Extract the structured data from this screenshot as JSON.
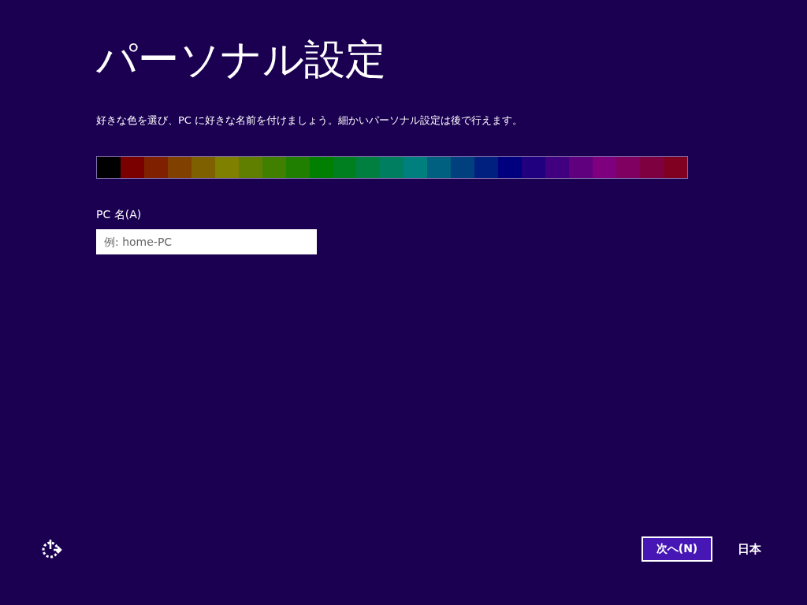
{
  "title": "パーソナル設定",
  "description": "好きな色を選び、PC に好きな名前を付けましょう。細かいパーソナル設定は後で行えます。",
  "swatches": [
    {
      "color": "#000000"
    },
    {
      "color": "#7a0000"
    },
    {
      "color": "#7f2000"
    },
    {
      "color": "#7f4000"
    },
    {
      "color": "#7f6000"
    },
    {
      "color": "#7f7f00"
    },
    {
      "color": "#607f00"
    },
    {
      "color": "#407f00"
    },
    {
      "color": "#207f00"
    },
    {
      "color": "#007f00"
    },
    {
      "color": "#007f20"
    },
    {
      "color": "#007f40"
    },
    {
      "color": "#007f60"
    },
    {
      "color": "#007f7f"
    },
    {
      "color": "#00607f"
    },
    {
      "color": "#00407f"
    },
    {
      "color": "#00207f"
    },
    {
      "color": "#00007f"
    },
    {
      "color": "#20007f"
    },
    {
      "color": "#40007f"
    },
    {
      "color": "#60007f"
    },
    {
      "color": "#7f007f"
    },
    {
      "color": "#7f0060"
    },
    {
      "color": "#7f0040"
    },
    {
      "color": "#7f0020"
    }
  ],
  "pc_name": {
    "label": "PC 名(A)",
    "placeholder": "例: home-PC"
  },
  "next_button": "次へ(N)",
  "language": "日本"
}
